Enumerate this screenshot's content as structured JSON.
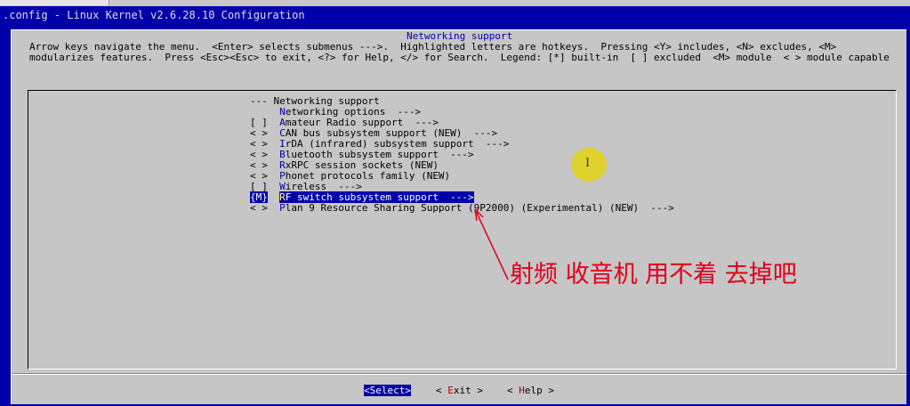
{
  "window": {
    "tab_label": "",
    "title": ".config - Linux Kernel v2.6.28.10 Configuration"
  },
  "dialog": {
    "title": "Networking support",
    "help_line_1": "Arrow keys navigate the menu.  <Enter> selects submenus --->.  Highlighted letters are hotkeys.  Pressing <Y> includes, <N> excludes, <M>",
    "help_line_2": "modularizes features.  Press <Esc><Esc> to exit, <?> for Help, </> for Search.  Legend: [*] built-in  [ ] excluded  <M> module  < > module capable"
  },
  "menu": [
    {
      "mark": "---",
      "hot": "",
      "rest": " Networking support",
      "selected": false
    },
    {
      "mark": "   ",
      "hot": "N",
      "rest": "etworking options  --->",
      "selected": false
    },
    {
      "mark": "[ ]",
      "hot": "A",
      "rest": "mateur Radio support  --->",
      "selected": false
    },
    {
      "mark": "< >",
      "hot": "C",
      "rest": "AN bus subsystem support (NEW)  --->",
      "selected": false
    },
    {
      "mark": "< >",
      "hot": "I",
      "rest": "rDA (infrared) subsystem support  --->",
      "selected": false
    },
    {
      "mark": "< >",
      "hot": "B",
      "rest": "luetooth subsystem support  --->",
      "selected": false
    },
    {
      "mark": "< >",
      "hot": "R",
      "rest": "xRPC session sockets (NEW)",
      "selected": false
    },
    {
      "mark": "< >",
      "hot": "P",
      "rest": "honet protocols family (NEW)",
      "selected": false
    },
    {
      "mark": "[ ]",
      "hot": "W",
      "rest": "ireless  --->",
      "selected": false
    },
    {
      "mark": "{M}",
      "hot": "R",
      "rest": "F switch subsystem support  --->",
      "selected": true
    },
    {
      "mark": "< >",
      "hot": "P",
      "rest": "lan 9 Resource Sharing Support (9P2000) (Experimental) (NEW)  --->",
      "selected": false
    }
  ],
  "buttons": {
    "select": {
      "open": "<",
      "hot": "S",
      "rest": "elect>"
    },
    "exit": {
      "open": "< ",
      "hot": "E",
      "rest": "xit >"
    },
    "help": {
      "open": "< ",
      "hot": "H",
      "rest": "elp >"
    }
  },
  "annotation": {
    "text": "射频 收音机 用不着 去掉吧",
    "color": "#e0001a"
  },
  "colors": {
    "frame_blue": "#0000aa",
    "dialog_gray": "#c6c6c6",
    "highlight_text": "#ffffff"
  }
}
